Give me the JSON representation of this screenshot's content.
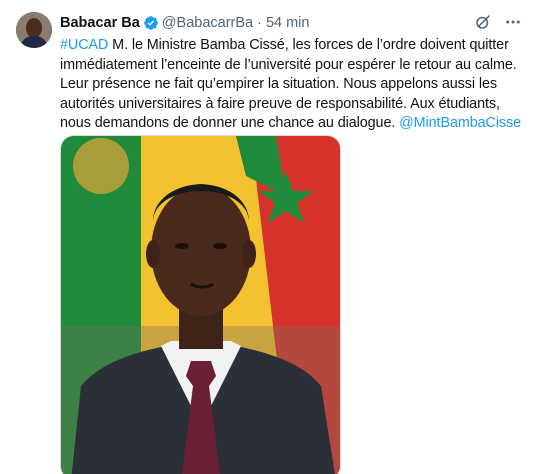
{
  "tweet": {
    "display_name": "Babacar Ba",
    "handle": "@BabacarrBa",
    "separator": "·",
    "time": "54 min",
    "text_parts": [
      {
        "kind": "hashtag",
        "text": "#UCAD"
      },
      {
        "kind": "text",
        "text": " M. le Ministre Bamba Cissé, les forces de l’ordre doivent quitter\nimmédiatement l’enceinte de l’université pour espérer le retour au calme.\nLeur présence ne fait qu’empirer la situation. Nous appelons aussi les\nautorités universitaires à faire preuve de responsabilité. Aux étudiants,\nnous demandons de donner une chance au dialogue. "
      },
      {
        "kind": "mention",
        "text": "@MintBambaCisse"
      }
    ]
  },
  "icons": {
    "verified": "verified-badge-icon",
    "grok": "grok-icon",
    "more": "more-icon"
  },
  "colors": {
    "link": "#1d9bf0",
    "verified": "#1d9bf0",
    "secondary_text": "#536471",
    "flag_green": "#1e8a3a",
    "flag_yellow": "#f2c230",
    "flag_red": "#d4322b"
  }
}
